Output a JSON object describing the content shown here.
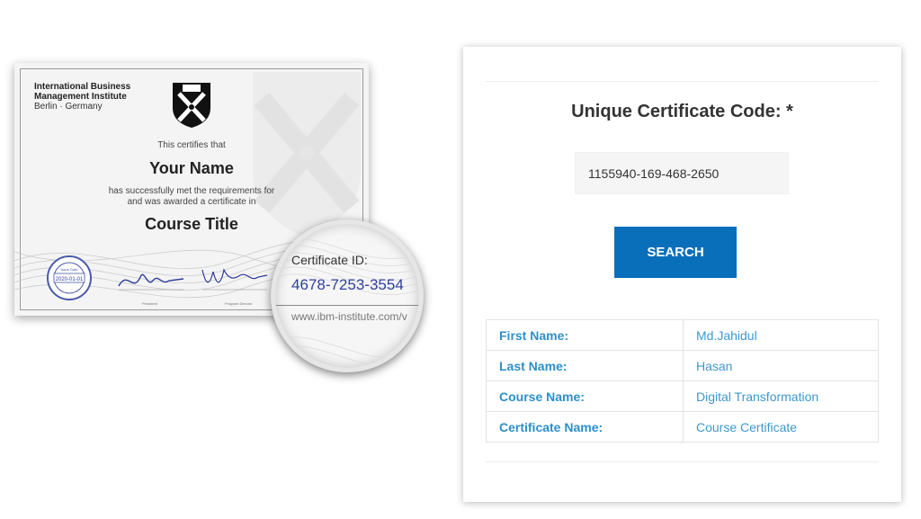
{
  "certificate_sample": {
    "org_line1": "International Business",
    "org_line2": "Management Institute",
    "location": "Berlin · Germany",
    "certifies": "This certifies that",
    "name": "Your Name",
    "requirements_line1": "has successfully met the requirements for",
    "requirements_line2": "and was awarded a certificate in",
    "course_title": "Course Title",
    "seal_title": "Issue Date",
    "seal_date": "2020-01-01",
    "signer1_title": "President",
    "signer2_title": "Program Director",
    "magnifier": {
      "id_label": "Certificate ID:",
      "id_value": "4678-7253-3554",
      "url": "www.ibm-institute.com/v"
    }
  },
  "verify_form": {
    "code_label": "Unique Certificate Code: *",
    "code_value": "1155940-169-468-2650",
    "search_label": "SEARCH"
  },
  "results": {
    "rows": [
      {
        "label": "First Name:",
        "value": "Md.Jahidul"
      },
      {
        "label": "Last Name:",
        "value": "Hasan"
      },
      {
        "label": "Course Name:",
        "value": "Digital Transformation"
      },
      {
        "label": "Certificate Name:",
        "value": "Course Certificate"
      }
    ]
  },
  "colors": {
    "button": "#0a6fba",
    "label_blue": "#2d8fc9",
    "id_blue": "#2f3f9e"
  }
}
